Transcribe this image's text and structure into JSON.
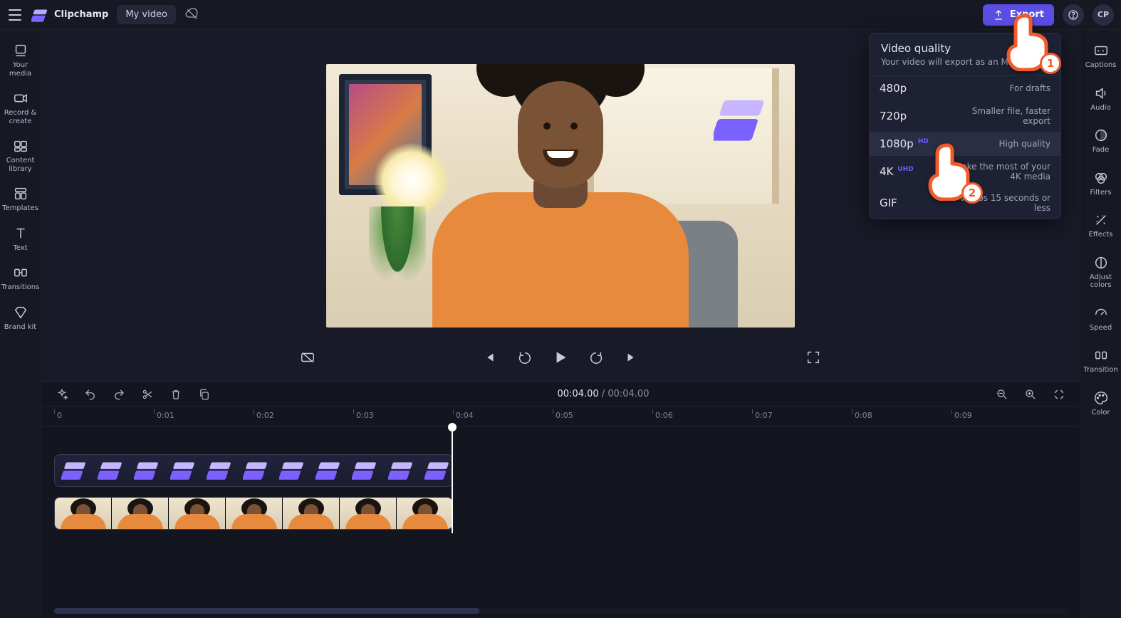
{
  "header": {
    "brand": "Clipchamp",
    "project_title": "My video",
    "export_label": "Export",
    "avatar_initials": "CP"
  },
  "left_nav": {
    "items": [
      {
        "label": "Your media"
      },
      {
        "label": "Record & create"
      },
      {
        "label": "Content library"
      },
      {
        "label": "Templates"
      },
      {
        "label": "Text"
      },
      {
        "label": "Transitions"
      },
      {
        "label": "Brand kit"
      }
    ]
  },
  "right_nav": {
    "items": [
      {
        "label": "Captions"
      },
      {
        "label": "Audio"
      },
      {
        "label": "Fade"
      },
      {
        "label": "Filters"
      },
      {
        "label": "Effects"
      },
      {
        "label": "Adjust colors"
      },
      {
        "label": "Speed"
      },
      {
        "label": "Transition"
      },
      {
        "label": "Color"
      }
    ]
  },
  "export_menu": {
    "title": "Video quality",
    "subtitle": "Your video will export as an MP4 file",
    "options": [
      {
        "label": "480p",
        "badge": "",
        "desc": "For drafts",
        "selected": false
      },
      {
        "label": "720p",
        "badge": "",
        "desc": "Smaller file, faster export",
        "selected": false
      },
      {
        "label": "1080p",
        "badge": "HD",
        "desc": "High quality",
        "selected": true
      },
      {
        "label": "4K",
        "badge": "UHD",
        "desc": "Make the most of your 4K media",
        "selected": false
      },
      {
        "label": "GIF",
        "badge": "",
        "desc": "For videos 15 seconds or less",
        "selected": false
      }
    ]
  },
  "timecode": {
    "current": "00:04.00",
    "duration": "00:04.00",
    "sep": " / "
  },
  "ruler": {
    "labels": [
      "0",
      "0:01",
      "0:02",
      "0:03",
      "0:04",
      "0:05",
      "0:06",
      "0:07",
      "0:08",
      "0:09"
    ]
  },
  "annotations": {
    "step1": "1",
    "step2": "2"
  }
}
